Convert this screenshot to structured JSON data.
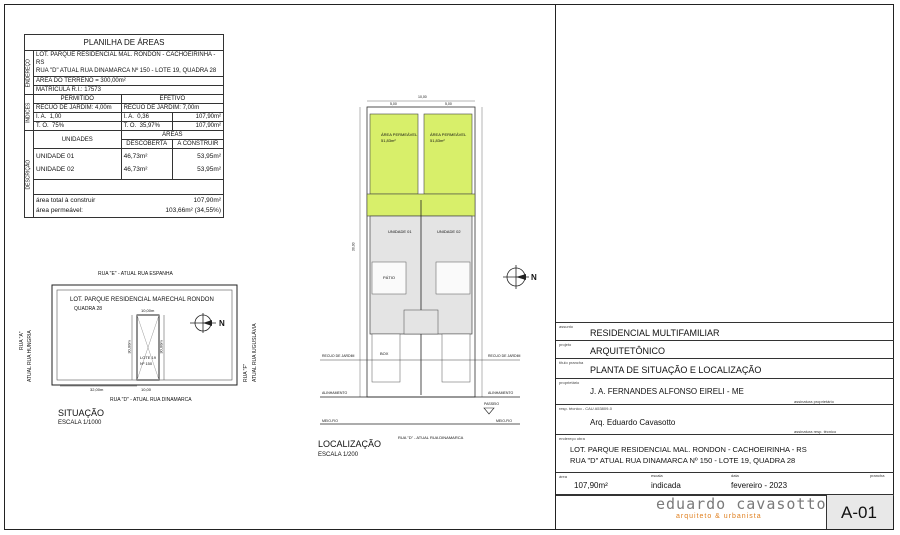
{
  "planilha": {
    "title": "PLANILHA DE ÁREAS",
    "side_endereco": "ENDEREÇO",
    "side_indices": "ÍNDICES",
    "side_descricao": "DESCRIÇÃO",
    "addr1": "LOT. PARQUE RESIDENCIAL MAL. RONDON - CACHOEIRINHA - RS",
    "addr2": "RUA \"D\" ATUAL RUA DINAMARCA Nº 150 - LOTE 19, QUADRA 28",
    "area_terreno": "ÁREA DO TERRENO = 300,00m²",
    "matricula": "MATRÍCULA R.I.:   17573",
    "permitido": "PERMITIDO",
    "efetivo": "EFETIVO",
    "recuo_perm": "RECUO DE JARDIM: 4,00m",
    "recuo_efet": "RECUO DE JARDIM: 7,00m",
    "ia_label": "I. A.",
    "ia_perm": "1,00",
    "ia_efet_label": "I. A.",
    "ia_efet": "0,36",
    "ia_area": "107,90m²",
    "to_label": "T. O.",
    "to_perm": "75%",
    "to_efet_label": "T. O.",
    "to_efet": "35,97%",
    "to_area": "107,90m²",
    "unidades": "UNIDADES",
    "areas": "ÁREAS",
    "descoberta": "DESCOBERTA",
    "a_construir": "A CONSTRUIR",
    "u1": "UNIDADE 01",
    "u1_desc": "46,73m²",
    "u1_const": "53,95m²",
    "u2": "UNIDADE 02",
    "u2_desc": "46,73m²",
    "u2_const": "53,95m²",
    "area_total_label": "área total à construir",
    "area_total": "107,90m²",
    "area_perm_label": "área permeável:",
    "area_perm": "103,66m² (34,55%)"
  },
  "situacao": {
    "rua_e": "RUA \"E\" - ATUAL RUA ESPANHA",
    "lot_name": "LOT. PARQUE RESIDENCIAL MARECHAL RONDON",
    "quadra": "QUADRA 28",
    "rua_a": "RUA \"A\"",
    "rua_a2": "ATUAL RUA HUNGRIA",
    "rua_f": "RUA \"F\"",
    "rua_f2": "ATUAL RUA IUGUSLÁVIA",
    "rua_d": "RUA \"D\" - ATUAL RUA DINAMARCA",
    "dim_32": "32,00m",
    "dim_10_top": "10,00m",
    "dim_10_bot": "10,00",
    "dim_30a": "30,00m",
    "dim_30b": "30,00m",
    "lote_label": "LOTE 19",
    "lote_num": "Nº 150",
    "north": "N",
    "title": "SITUAÇÃO",
    "scale": "ESCALA 1/1000"
  },
  "localizacao": {
    "area_perm1": "ÁREA PERMEÁVEL",
    "area_perm1_val": "51,83m²",
    "area_perm2": "ÁREA PERMEÁVEL",
    "area_perm2_val": "51,83m²",
    "unidade1": "UNIDADE 01",
    "unidade2": "UNIDADE 02",
    "patio": "PÁTIO",
    "box": "BOX",
    "recuo_jardim_l": "RECUO DE JARDIM",
    "recuo_jardim_r": "RECUO DE JARDIM",
    "alinhamento_l": "ALINHAMENTO",
    "alinhamento_r": "ALINHAMENTO",
    "meio_fio_l": "MEIO-FIO",
    "meio_fio_r": "MEIO-FIO",
    "passeio": "PASSEIO",
    "street": "RUA \"D\" - ATUAL RUA DINAMARCA",
    "north": "N",
    "title": "LOCALIZAÇÃO",
    "scale": "ESCALA 1/200",
    "dim_top": "10,00",
    "dim_500a": "5,00",
    "dim_500b": "5,00",
    "dim_side": "30,00"
  },
  "titleblock": {
    "assunto_lbl": "assunto",
    "assunto": "RESIDENCIAL MULTIFAMILIAR",
    "projeto_lbl": "projeto",
    "projeto": "ARQUITETÔNICO",
    "titulo_lbl": "título prancha",
    "titulo": "PLANTA DE SITUAÇÃO E LOCALIZAÇÃO",
    "proprietario_lbl": "proprietário",
    "proprietario": "J. A. FERNANDES ALFONSO EIRELI - ME",
    "ass_prop": "assinatura proprietário",
    "resp_lbl": "resp. técnico - CAU A53809-0",
    "resp": "Arq. Eduardo Cavasotto",
    "ass_resp": "assinatura resp. técnico",
    "endereco_lbl": "endereço obra",
    "endereco1": "LOT. PARQUE RESIDENCIAL MAL. RONDON - CACHOEIRINHA - RS",
    "endereco2": "RUA \"D\" ATUAL RUA DINAMARCA Nº 150 - LOTE 19, QUADRA 28",
    "area_lbl": "área",
    "area": "107,90m²",
    "escala_lbl": "escala",
    "escala": "indicada",
    "data_lbl": "data",
    "data": "fevereiro - 2023",
    "prancha_lbl": "prancha",
    "brand1": "eduardo cavasotto",
    "brand2": "arquiteto & urbanista",
    "prancha": "A-01"
  }
}
